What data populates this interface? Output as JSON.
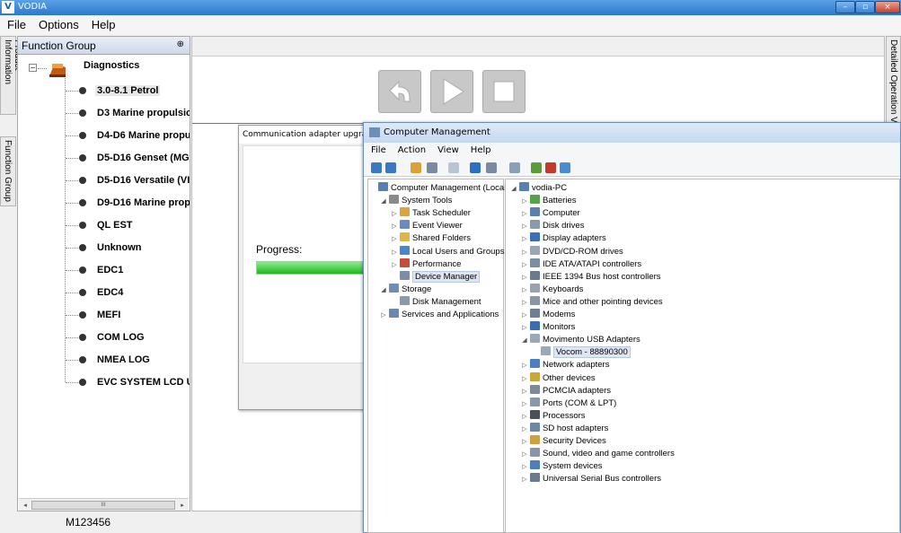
{
  "vodia": {
    "title": "VODIA",
    "logo_text": "V",
    "menu": [
      "File",
      "Options",
      "Help"
    ],
    "window_buttons": {
      "minimize": "–",
      "maximize": "▫",
      "close": "×"
    },
    "side_tabs": {
      "product_info": "Product Information",
      "function_group": "Function Group",
      "detailed_operation": "Detailed Operation Vi"
    },
    "function_group": {
      "header": "Function Group",
      "pin": "⊕",
      "root": "Diagnostics",
      "items": [
        "3.0-8.1 Petrol",
        "D3 Marine propulsic",
        "D4-D6 Marine propu",
        "D5-D16 Genset (MG",
        "D5-D16 Versatile (VI",
        "D9-D16 Marine prop",
        "QL EST",
        "Unknown",
        "EDC1",
        "EDC4",
        "MEFI",
        "COM LOG",
        "NMEA LOG",
        "EVC SYSTEM LCD U"
      ],
      "selected_index": 0,
      "scroll_left": "◂",
      "scroll_right": "▸",
      "scroll_grip": "III"
    },
    "status_text": "M123456"
  },
  "comm_dialog": {
    "title": "Communication adapter upgrade",
    "progress_label": "Progress:",
    "progress_fraction": 0.83,
    "progress_color": "#22bb22"
  },
  "computer_management": {
    "title": "Computer Management",
    "menu": [
      "File",
      "Action",
      "View",
      "Help"
    ],
    "left_tree": [
      {
        "label": "Computer Management (Local",
        "indent": 0,
        "icon": "computer-icon",
        "exp": ""
      },
      {
        "label": "System Tools",
        "indent": 1,
        "icon": "tools-icon",
        "exp": "◢"
      },
      {
        "label": "Task Scheduler",
        "indent": 2,
        "icon": "clock-icon",
        "exp": "▷"
      },
      {
        "label": "Event Viewer",
        "indent": 2,
        "icon": "log-icon",
        "exp": "▷"
      },
      {
        "label": "Shared Folders",
        "indent": 2,
        "icon": "folder-icon",
        "exp": "▷"
      },
      {
        "label": "Local Users and Groups",
        "indent": 2,
        "icon": "users-icon",
        "exp": "▷"
      },
      {
        "label": "Performance",
        "indent": 2,
        "icon": "performance-icon",
        "exp": "▷"
      },
      {
        "label": "Device Manager",
        "indent": 2,
        "icon": "device-manager-icon",
        "exp": "",
        "selected": true
      },
      {
        "label": "Storage",
        "indent": 1,
        "icon": "storage-icon",
        "exp": "◢"
      },
      {
        "label": "Disk Management",
        "indent": 2,
        "icon": "disk-icon",
        "exp": ""
      },
      {
        "label": "Services and Applications",
        "indent": 1,
        "icon": "services-icon",
        "exp": "▷"
      }
    ],
    "device_tree": [
      {
        "label": "vodia-PC",
        "indent": 0,
        "icon": "computer-icon",
        "exp": "◢"
      },
      {
        "label": "Batteries",
        "indent": 1,
        "icon": "battery-icon",
        "exp": "▷"
      },
      {
        "label": "Computer",
        "indent": 1,
        "icon": "computer-icon",
        "exp": "▷"
      },
      {
        "label": "Disk drives",
        "indent": 1,
        "icon": "disk-icon",
        "exp": "▷"
      },
      {
        "label": "Display adapters",
        "indent": 1,
        "icon": "display-icon",
        "exp": "▷"
      },
      {
        "label": "DVD/CD-ROM drives",
        "indent": 1,
        "icon": "dvd-icon",
        "exp": "▷"
      },
      {
        "label": "IDE ATA/ATAPI controllers",
        "indent": 1,
        "icon": "ide-icon",
        "exp": "▷"
      },
      {
        "label": "IEEE 1394 Bus host controllers",
        "indent": 1,
        "icon": "ieee-icon",
        "exp": "▷"
      },
      {
        "label": "Keyboards",
        "indent": 1,
        "icon": "keyboard-icon",
        "exp": "▷"
      },
      {
        "label": "Mice and other pointing devices",
        "indent": 1,
        "icon": "mouse-icon",
        "exp": "▷"
      },
      {
        "label": "Modems",
        "indent": 1,
        "icon": "modem-icon",
        "exp": "▷"
      },
      {
        "label": "Monitors",
        "indent": 1,
        "icon": "monitor-icon",
        "exp": "▷"
      },
      {
        "label": "Movimento USB Adapters",
        "indent": 1,
        "icon": "usb-adapter-icon",
        "exp": "◢"
      },
      {
        "label": "Vocom - 88890300",
        "indent": 2,
        "icon": "usb-adapter-icon",
        "exp": "",
        "selected": true
      },
      {
        "label": "Network adapters",
        "indent": 1,
        "icon": "network-icon",
        "exp": "▷"
      },
      {
        "label": "Other devices",
        "indent": 1,
        "icon": "other-devices-icon",
        "exp": "▷"
      },
      {
        "label": "PCMCIA adapters",
        "indent": 1,
        "icon": "pcmcia-icon",
        "exp": "▷"
      },
      {
        "label": "Ports (COM & LPT)",
        "indent": 1,
        "icon": "port-icon",
        "exp": "▷"
      },
      {
        "label": "Processors",
        "indent": 1,
        "icon": "processor-icon",
        "exp": "▷"
      },
      {
        "label": "SD host adapters",
        "indent": 1,
        "icon": "sd-icon",
        "exp": "▷"
      },
      {
        "label": "Security Devices",
        "indent": 1,
        "icon": "security-icon",
        "exp": "▷"
      },
      {
        "label": "Sound, video and game controllers",
        "indent": 1,
        "icon": "sound-icon",
        "exp": "▷"
      },
      {
        "label": "System devices",
        "indent": 1,
        "icon": "system-icon",
        "exp": "▷"
      },
      {
        "label": "Universal Serial Bus controllers",
        "indent": 1,
        "icon": "usb-icon",
        "exp": "▷"
      }
    ]
  }
}
